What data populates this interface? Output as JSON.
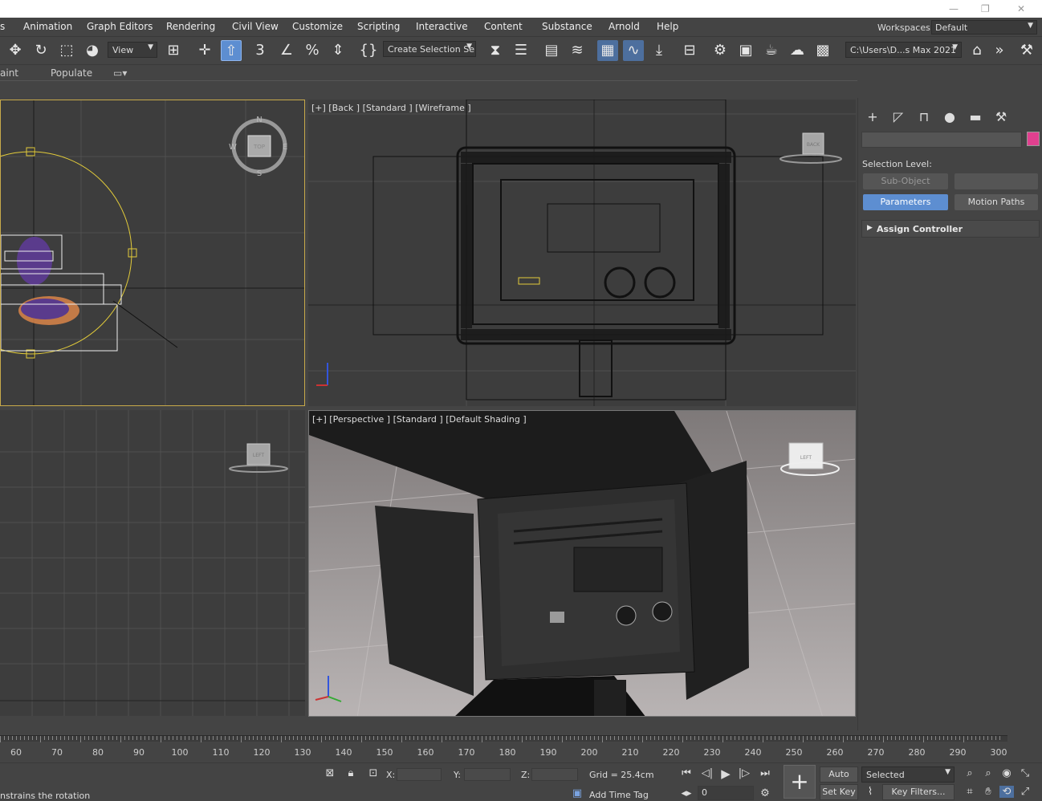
{
  "menus": [
    "s",
    "Animation",
    "Graph Editors",
    "Rendering",
    "Civil View",
    "Customize",
    "Scripting",
    "Interactive",
    "Content",
    "Substance",
    "Arnold",
    "Help"
  ],
  "workspace": {
    "label": "Workspaces:",
    "value": "Default"
  },
  "toolbar": {
    "view_dropdown": "View",
    "selection_set": "Create Selection Se",
    "project_path": "C:\\Users\\D...s Max 2021"
  },
  "ribbon": {
    "paint": "aint",
    "populate": "Populate"
  },
  "viewports": {
    "top": {
      "compass": {
        "n": "N",
        "s": "S",
        "e": "E",
        "w": "W",
        "cube": "TOP"
      }
    },
    "back": {
      "label": "[+] [Back ] [Standard ] [Wireframe ]",
      "cube": "BACK"
    },
    "left": {
      "cube": "LEFT"
    },
    "perspective": {
      "label": "[+] [Perspective ] [Standard ] [Default Shading ]",
      "cube": "LEFT"
    }
  },
  "command_panel": {
    "selection_level": "Selection Level:",
    "sub_object": "Sub-Object",
    "parameters": "Parameters",
    "motion_paths": "Motion Paths",
    "assign_controller": "Assign Controller",
    "color": "#e0408f"
  },
  "timeline": {
    "ticks": [
      "60",
      "70",
      "80",
      "90",
      "100",
      "110",
      "120",
      "130",
      "140",
      "150",
      "160",
      "170",
      "180",
      "190",
      "200",
      "210",
      "220",
      "230",
      "240",
      "250",
      "260",
      "270",
      "280",
      "290",
      "300"
    ]
  },
  "status": {
    "prompt": "nstrains the rotation",
    "x_label": "X:",
    "y_label": "Y:",
    "z_label": "Z:",
    "grid": "Grid = 25.4cm",
    "add_time_tag": "Add Time Tag",
    "auto_key": "Auto Key",
    "set_key": "Set Key",
    "selected": "Selected",
    "key_filters": "Key Filters...",
    "frame": "0"
  },
  "colors": {
    "accent": "#5d8ed1",
    "bg": "#444444",
    "viewport": "#3d3d3d",
    "perspective_floor": "#a09b9b"
  }
}
